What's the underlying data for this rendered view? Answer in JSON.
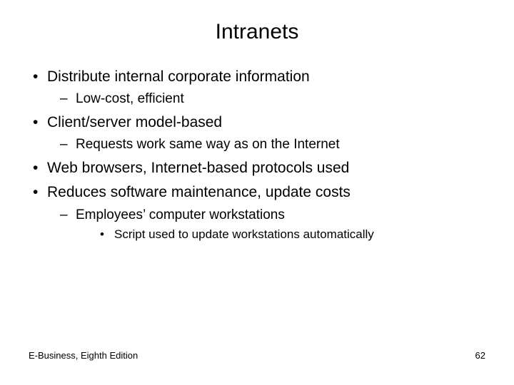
{
  "title": "Intranets",
  "bullets": {
    "b0": "Distribute internal corporate information",
    "b0_s0": "Low-cost, efficient",
    "b1": "Client/server model-based",
    "b1_s0": "Requests work same way as on the Internet",
    "b2": "Web browsers, Internet-based protocols used",
    "b3": "Reduces software maintenance, update costs",
    "b3_s0": "Employees’ computer workstations",
    "b3_s0_s0": "Script used to update workstations automatically"
  },
  "footer": {
    "left": "E-Business, Eighth Edition",
    "right": "62"
  }
}
